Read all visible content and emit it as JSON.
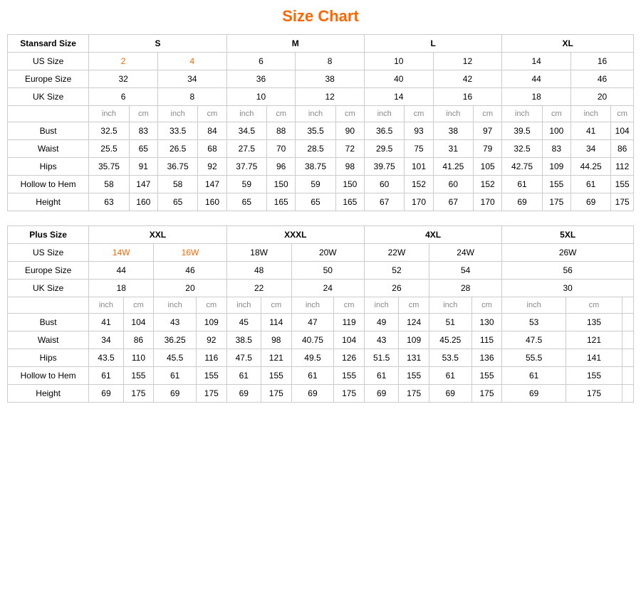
{
  "title": "Size Chart",
  "standard": {
    "label": "Stansard Size",
    "sizes": [
      "S",
      "M",
      "L",
      "XL"
    ],
    "us_label": "US Size",
    "us_values": [
      "2",
      "4",
      "6",
      "8",
      "10",
      "12",
      "14",
      "16"
    ],
    "europe_label": "Europe Size",
    "europe_values": [
      "32",
      "34",
      "36",
      "38",
      "40",
      "42",
      "44",
      "46"
    ],
    "uk_label": "UK Size",
    "uk_values": [
      "6",
      "8",
      "10",
      "12",
      "14",
      "16",
      "18",
      "20"
    ],
    "unit_inch": "inch",
    "unit_cm": "cm",
    "measurements": [
      {
        "label": "Bust",
        "values": [
          "32.5",
          "83",
          "33.5",
          "84",
          "34.5",
          "88",
          "35.5",
          "90",
          "36.5",
          "93",
          "38",
          "97",
          "39.5",
          "100",
          "41",
          "104"
        ]
      },
      {
        "label": "Waist",
        "values": [
          "25.5",
          "65",
          "26.5",
          "68",
          "27.5",
          "70",
          "28.5",
          "72",
          "29.5",
          "75",
          "31",
          "79",
          "32.5",
          "83",
          "34",
          "86"
        ]
      },
      {
        "label": "Hips",
        "values": [
          "35.75",
          "91",
          "36.75",
          "92",
          "37.75",
          "96",
          "38.75",
          "98",
          "39.75",
          "101",
          "41.25",
          "105",
          "42.75",
          "109",
          "44.25",
          "112"
        ]
      },
      {
        "label": "Hollow to Hem",
        "values": [
          "58",
          "147",
          "58",
          "147",
          "59",
          "150",
          "59",
          "150",
          "60",
          "152",
          "60",
          "152",
          "61",
          "155",
          "61",
          "155"
        ]
      },
      {
        "label": "Height",
        "values": [
          "63",
          "160",
          "65",
          "160",
          "65",
          "165",
          "65",
          "165",
          "67",
          "170",
          "67",
          "170",
          "69",
          "175",
          "69",
          "175"
        ]
      }
    ]
  },
  "plus": {
    "label": "Plus Size",
    "sizes": [
      "XXL",
      "XXXL",
      "4XL",
      "5XL"
    ],
    "us_label": "US Size",
    "us_values": [
      "14W",
      "16W",
      "18W",
      "20W",
      "22W",
      "24W",
      "26W"
    ],
    "europe_label": "Europe Size",
    "europe_values": [
      "44",
      "46",
      "48",
      "50",
      "52",
      "54",
      "56"
    ],
    "uk_label": "UK Size",
    "uk_values": [
      "18",
      "20",
      "22",
      "24",
      "26",
      "28",
      "30"
    ],
    "unit_inch": "inch",
    "unit_cm": "cm",
    "measurements": [
      {
        "label": "Bust",
        "values": [
          "41",
          "104",
          "43",
          "109",
          "45",
          "114",
          "47",
          "119",
          "49",
          "124",
          "51",
          "130",
          "53",
          "135"
        ]
      },
      {
        "label": "Waist",
        "values": [
          "34",
          "86",
          "36.25",
          "92",
          "38.5",
          "98",
          "40.75",
          "104",
          "43",
          "109",
          "45.25",
          "115",
          "47.5",
          "121"
        ]
      },
      {
        "label": "Hips",
        "values": [
          "43.5",
          "110",
          "45.5",
          "116",
          "47.5",
          "121",
          "49.5",
          "126",
          "51.5",
          "131",
          "53.5",
          "136",
          "55.5",
          "141"
        ]
      },
      {
        "label": "Hollow to Hem",
        "values": [
          "61",
          "155",
          "61",
          "155",
          "61",
          "155",
          "61",
          "155",
          "61",
          "155",
          "61",
          "155",
          "61",
          "155"
        ]
      },
      {
        "label": "Height",
        "values": [
          "69",
          "175",
          "69",
          "175",
          "69",
          "175",
          "69",
          "175",
          "69",
          "175",
          "69",
          "175",
          "69",
          "175"
        ]
      }
    ]
  }
}
